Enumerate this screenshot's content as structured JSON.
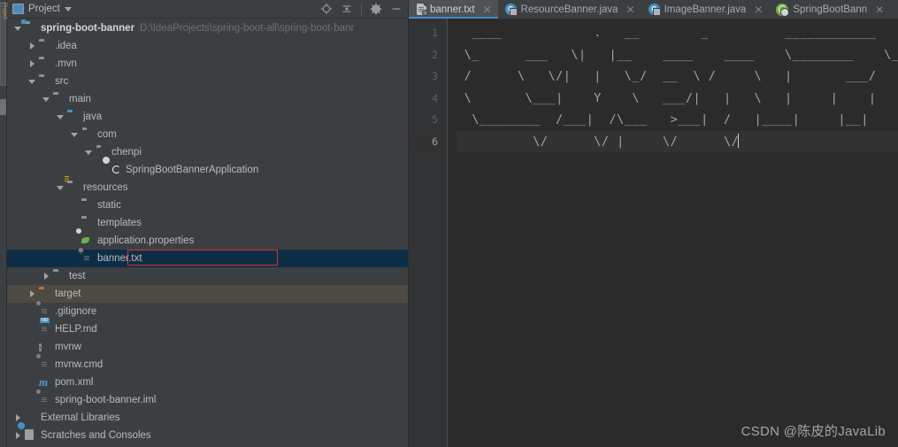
{
  "window": {
    "theme_bg": "#3c3f41",
    "editor_bg": "#2b2b2b",
    "accent": "#4a88c7",
    "selection": "#0d2d46",
    "highlight_box": "#e03030"
  },
  "left_strip": {
    "vertical_tab_label": "Project"
  },
  "panel": {
    "title": "Project",
    "icon": "project-panel-icon",
    "dropdown_icon": "chevron-down-icon",
    "tools": [
      {
        "name": "locate-icon",
        "label": "Select Opened File"
      },
      {
        "name": "collapse-all-icon",
        "label": "Collapse All"
      },
      {
        "name": "gear-icon",
        "label": "Settings"
      },
      {
        "name": "minimize-icon",
        "label": "Hide"
      }
    ]
  },
  "tree": {
    "items": [
      {
        "label": "spring-boot-banner",
        "path": "D:\\IdeaProjects\\spring-boot-all\\spring-boot-banr",
        "depth": 0,
        "arrow": "open",
        "icon": "module-folder-icon",
        "bold": true,
        "state": "normal"
      },
      {
        "label": ".idea",
        "path": "",
        "depth": 1,
        "arrow": "closed",
        "icon": "folder-icon",
        "bold": false,
        "state": "normal"
      },
      {
        "label": ".mvn",
        "path": "",
        "depth": 1,
        "arrow": "closed",
        "icon": "folder-icon",
        "bold": false,
        "state": "normal"
      },
      {
        "label": "src",
        "path": "",
        "depth": 1,
        "arrow": "open",
        "icon": "folder-icon",
        "bold": false,
        "state": "normal"
      },
      {
        "label": "main",
        "path": "",
        "depth": 2,
        "arrow": "open",
        "icon": "folder-icon",
        "bold": false,
        "state": "normal"
      },
      {
        "label": "java",
        "path": "",
        "depth": 3,
        "arrow": "open",
        "icon": "source-folder-icon",
        "bold": false,
        "state": "normal"
      },
      {
        "label": "com",
        "path": "",
        "depth": 4,
        "arrow": "open",
        "icon": "package-icon",
        "bold": false,
        "state": "normal"
      },
      {
        "label": "chenpi",
        "path": "",
        "depth": 5,
        "arrow": "open",
        "icon": "package-icon",
        "bold": false,
        "state": "normal"
      },
      {
        "label": "SpringBootBannerApplication",
        "path": "",
        "depth": 6,
        "arrow": "none",
        "icon": "spring-class-icon",
        "bold": false,
        "state": "normal"
      },
      {
        "label": "resources",
        "path": "",
        "depth": 3,
        "arrow": "open",
        "icon": "resources-folder-icon",
        "bold": false,
        "state": "normal"
      },
      {
        "label": "static",
        "path": "",
        "depth": 4,
        "arrow": "none",
        "icon": "folder-icon",
        "bold": false,
        "state": "normal"
      },
      {
        "label": "templates",
        "path": "",
        "depth": 4,
        "arrow": "none",
        "icon": "folder-icon",
        "bold": false,
        "state": "normal"
      },
      {
        "label": "application.properties",
        "path": "",
        "depth": 4,
        "arrow": "none",
        "icon": "properties-file-icon",
        "bold": false,
        "state": "normal"
      },
      {
        "label": "banner.txt",
        "path": "",
        "depth": 4,
        "arrow": "none",
        "icon": "text-file-icon",
        "bold": false,
        "state": "selected"
      },
      {
        "label": "test",
        "path": "",
        "depth": 2,
        "arrow": "closed",
        "icon": "folder-icon",
        "bold": false,
        "state": "normal"
      },
      {
        "label": "target",
        "path": "",
        "depth": 1,
        "arrow": "closed",
        "icon": "excluded-folder-icon",
        "bold": false,
        "state": "hover"
      },
      {
        "label": ".gitignore",
        "path": "",
        "depth": 1,
        "arrow": "none",
        "icon": "ignored-file-icon",
        "bold": false,
        "state": "normal"
      },
      {
        "label": "HELP.md",
        "path": "",
        "depth": 1,
        "arrow": "none",
        "icon": "markdown-file-icon",
        "bold": false,
        "state": "normal"
      },
      {
        "label": "mvnw",
        "path": "",
        "depth": 1,
        "arrow": "none",
        "icon": "shell-script-icon",
        "bold": false,
        "state": "normal"
      },
      {
        "label": "mvnw.cmd",
        "path": "",
        "depth": 1,
        "arrow": "none",
        "icon": "text-file-icon",
        "bold": false,
        "state": "normal"
      },
      {
        "label": "pom.xml",
        "path": "",
        "depth": 1,
        "arrow": "none",
        "icon": "maven-file-icon",
        "bold": false,
        "state": "normal"
      },
      {
        "label": "spring-boot-banner.iml",
        "path": "",
        "depth": 1,
        "arrow": "none",
        "icon": "iml-file-icon",
        "bold": false,
        "state": "normal"
      },
      {
        "label": "External Libraries",
        "path": "",
        "depth": 0,
        "arrow": "closed",
        "icon": "libraries-icon",
        "bold": false,
        "state": "normal"
      },
      {
        "label": "Scratches and Consoles",
        "path": "",
        "depth": 0,
        "arrow": "closed",
        "icon": "scratches-icon",
        "bold": false,
        "state": "normal"
      }
    ]
  },
  "editor": {
    "tabs": [
      {
        "label": "banner.txt",
        "icon": "text-file-icon",
        "active": true,
        "close_icon": "close-icon"
      },
      {
        "label": "ResourceBanner.java",
        "icon": "java-class-icon",
        "active": false,
        "close_icon": "close-icon"
      },
      {
        "label": "ImageBanner.java",
        "icon": "java-class-icon",
        "active": false,
        "close_icon": "close-icon"
      },
      {
        "label": "SpringBootBann",
        "icon": "spring-class-icon",
        "active": false,
        "close_icon": "close-icon"
      }
    ],
    "line_numbers": [
      "1",
      "2",
      "3",
      "4",
      "5",
      "6"
    ],
    "current_line": 6,
    "lines": [
      "  ____            .   __        _          ____________   .   __",
      " \\_      ___   \\|   |__    ____    ____    \\________    \\___|",
      " /      \\   \\/|   |   \\_/  __  \\ /     \\   |       ___/   |",
      " \\       \\___|    Y    \\   ___/|   |   \\   |     |    |   |",
      "  \\________  /___|  /\\___   >___|  /   |____|     |__|",
      "          \\/      \\/ |     \\/      \\/"
    ]
  },
  "watermark": "CSDN @陈皮的JavaLib"
}
